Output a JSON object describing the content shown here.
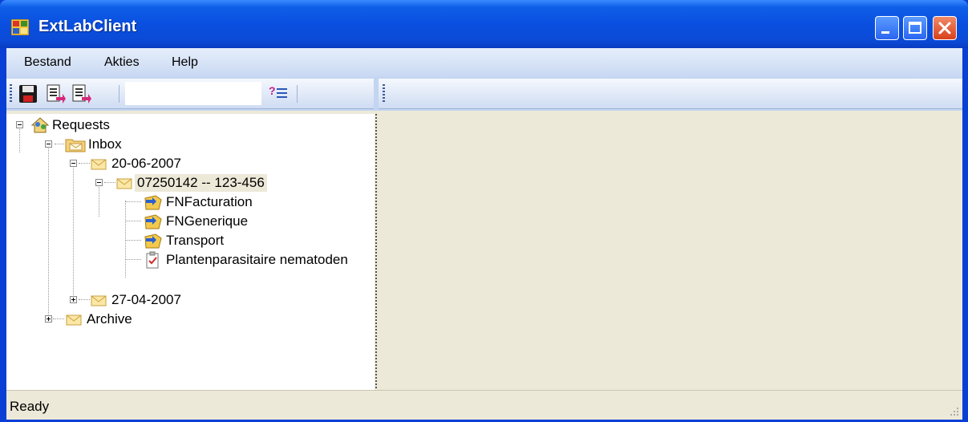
{
  "window": {
    "title": "ExtLabClient"
  },
  "menu": {
    "items": [
      "Bestand",
      "Akties",
      "Help"
    ]
  },
  "toolbar": {
    "buttons": [
      "save-icon",
      "export-icon",
      "import-icon",
      "help-list-icon"
    ],
    "search_value": ""
  },
  "tree": {
    "root": "Requests",
    "inbox": "Inbox",
    "date1": "20-06-2007",
    "request": "07250142 -- 123-456",
    "items": [
      "FNFacturation",
      "FNGenerique",
      "Transport",
      "Plantenparasitaire nematoden"
    ],
    "date2": "27-04-2007",
    "archive": "Archive"
  },
  "status": {
    "text": "Ready"
  },
  "colors": {
    "titlebar": "#0a4fe0",
    "close": "#d8401a",
    "toolbar": "#cfdcf3",
    "panel": "#ece9d8"
  }
}
